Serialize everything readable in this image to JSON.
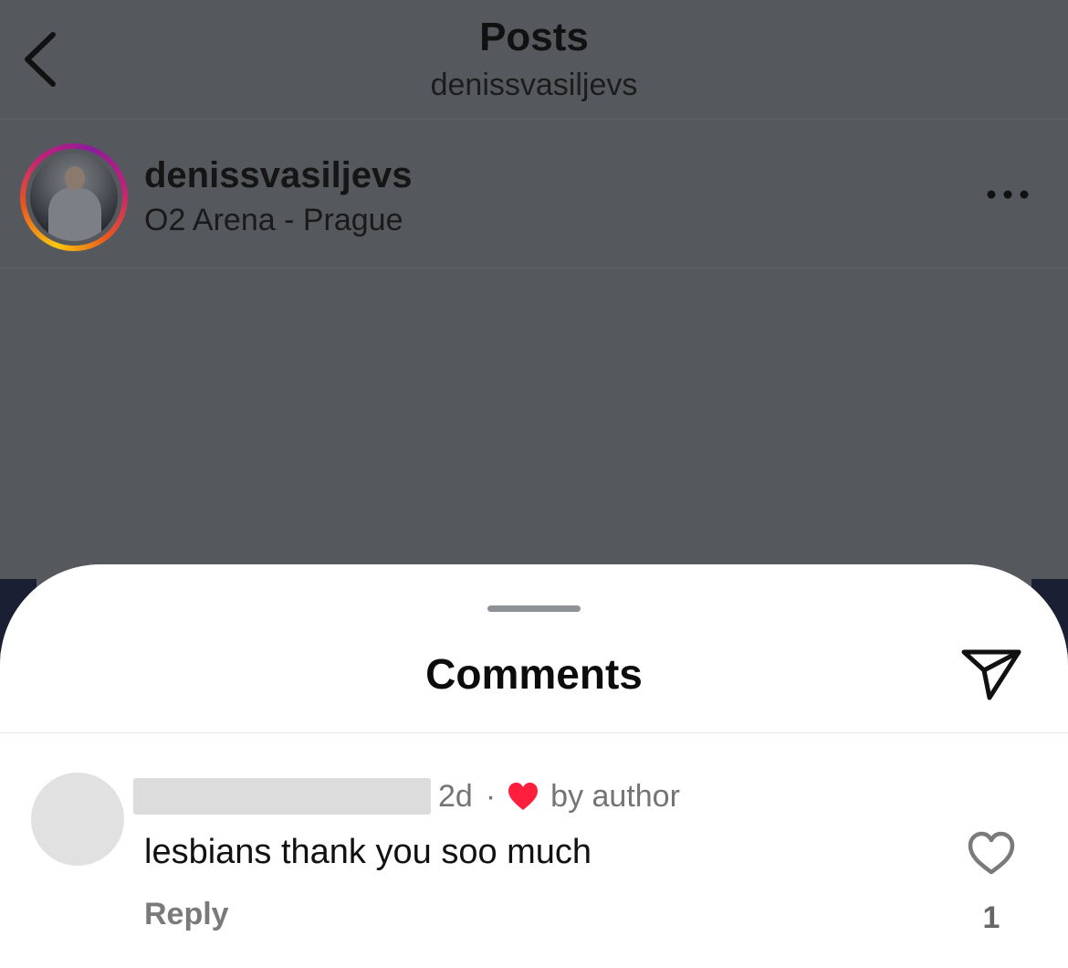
{
  "header": {
    "title": "Posts",
    "subtitle": "denissvasiljevs"
  },
  "post": {
    "username": "denissvasiljevs",
    "location": "O2 Arena - Prague",
    "more_icon": "more-horizontal-icon"
  },
  "comments_sheet": {
    "title": "Comments",
    "share_icon": "send-icon"
  },
  "comment": {
    "username_redacted": true,
    "time": "2d",
    "separator": "·",
    "liked_by_author_label": "by author",
    "text": "lesbians thank you soo much",
    "reply_label": "Reply",
    "like_count": "1",
    "heart_color": "#ff1f3d"
  }
}
